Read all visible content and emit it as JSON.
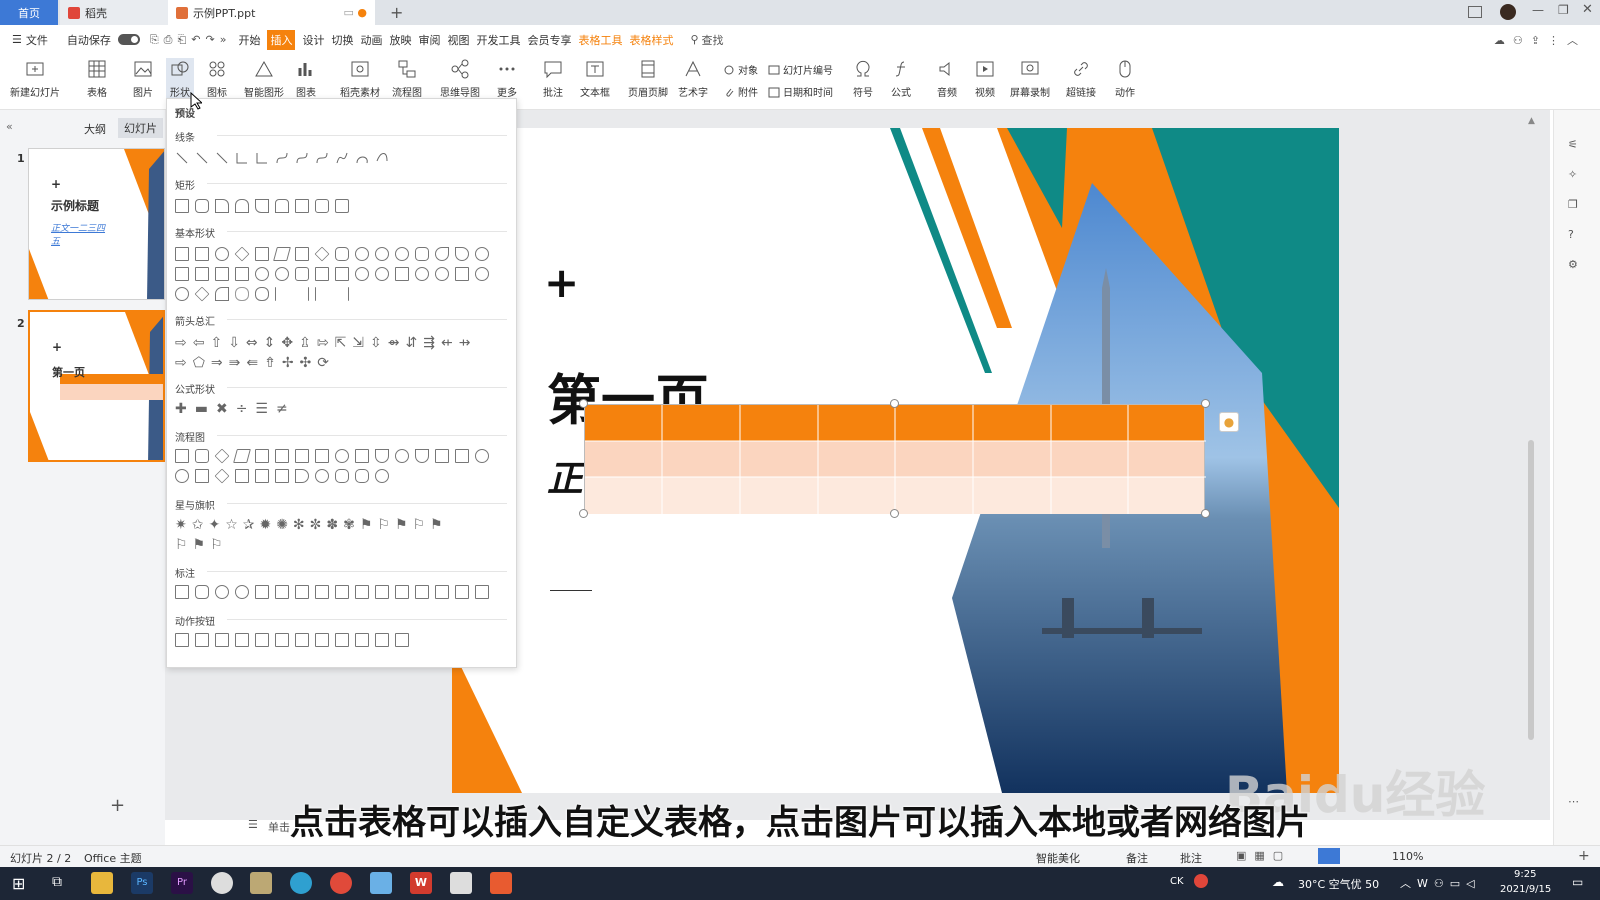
{
  "tabs": {
    "home": "首页",
    "daoke": "稻壳",
    "file": "示例PPT.ppt"
  },
  "menu": {
    "file": "文件",
    "autosave": "自动保存",
    "items": [
      "开始",
      "插入",
      "设计",
      "切换",
      "动画",
      "放映",
      "审阅",
      "视图",
      "开发工具",
      "会员专享",
      "表格工具",
      "表格样式"
    ],
    "active": "插入",
    "search": "查找"
  },
  "ribbon": {
    "new_slide": "新建幻灯片",
    "table": "表格",
    "picture": "图片",
    "shape": "形状",
    "icon": "图标",
    "smart_graphic": "智能图形",
    "chart": "图表",
    "daoke_material": "稻壳素材",
    "flowchart": "流程图",
    "mindmap": "思维导图",
    "more": "更多",
    "comment": "批注",
    "textbox": "文本框",
    "header_footer": "页眉页脚",
    "wordart": "艺术字",
    "object": "对象",
    "slide_number": "幻灯片编号",
    "attachment": "附件",
    "datetime": "日期和时间",
    "symbol": "符号",
    "formula": "公式",
    "audio": "音频",
    "video": "视频",
    "screen_record": "屏幕录制",
    "hyperlink": "超链接",
    "action": "动作"
  },
  "panel": {
    "outline": "大纲",
    "slides": "幻灯片",
    "thumb1_title": "示例标题",
    "thumb1_sub": "正文一二三四五",
    "thumb2_title": "第一页",
    "n1": "1",
    "n2": "2"
  },
  "dropdown": {
    "preset": "预设",
    "lines": "线条",
    "rect": "矩形",
    "basic": "基本形状",
    "arrows": "箭头总汇",
    "formula": "公式形状",
    "flow": "流程图",
    "stars": "星与旗帜",
    "callout": "标注",
    "action_btn": "动作按钮"
  },
  "slide": {
    "plus": "+",
    "title": "第一页",
    "sub": "正"
  },
  "notes": "单击",
  "status": {
    "slide_info": "幻灯片 2 / 2",
    "theme": "Office 主题",
    "beautify": "智能美化",
    "notes": "备注",
    "comment": "批注",
    "zoom": "110%"
  },
  "subtitle": "点击表格可以插入自定义表格，点击图片可以插入本地或者网络图片",
  "watermark": "Baidu经验",
  "taskbar": {
    "weather": "30°C 空气优 50",
    "time": "9:25",
    "date": "2021/9/15",
    "lang": "CK"
  },
  "colors": {
    "orange": "#f5820d",
    "teal": "#0f8a86",
    "blue": "#3d79d6",
    "peach": "#fbd5bf"
  }
}
